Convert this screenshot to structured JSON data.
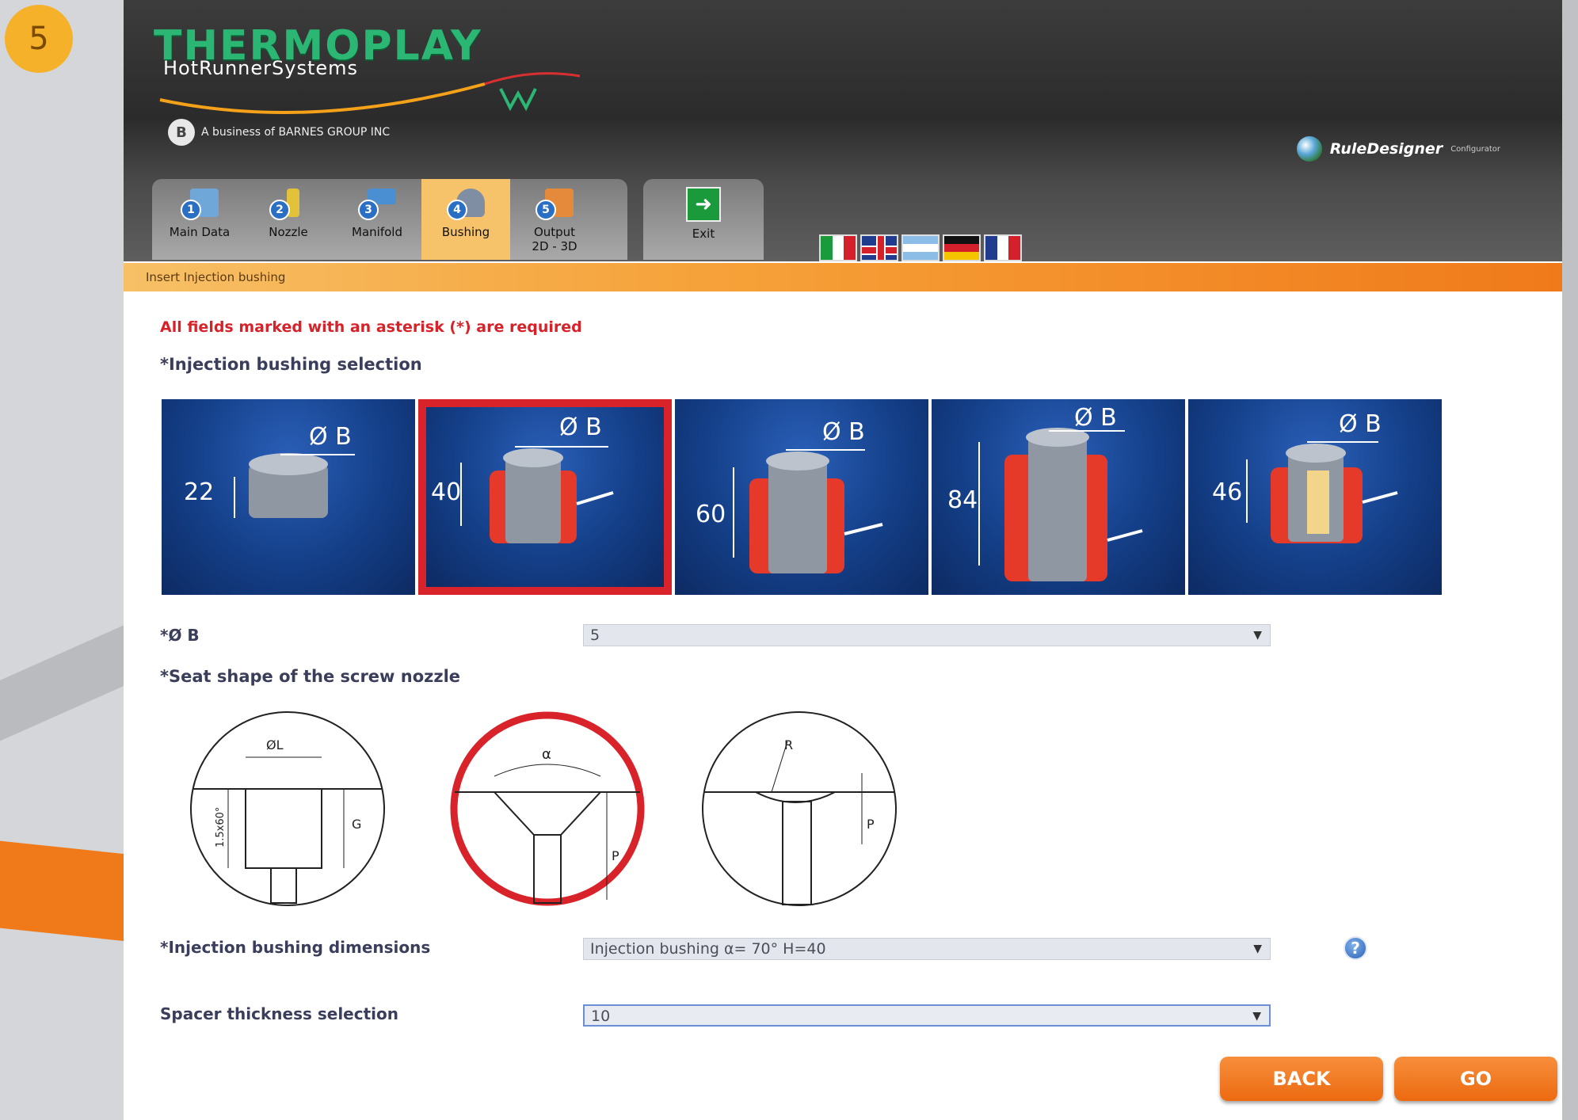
{
  "step_number": "5",
  "header": {
    "logo_title": "THERMOPLAY",
    "logo_subtitle": "HotRunnerSystems",
    "barnes_text": "A business of BARNES GROUP INC",
    "rule_designer": "RuleDesigner",
    "rule_designer_small": "Configurator"
  },
  "tabs": [
    {
      "number": "1",
      "label": "Main Data",
      "color": "#6fa7d8",
      "active": false
    },
    {
      "number": "2",
      "label": "Nozzle",
      "color": "#e2c23a",
      "active": false
    },
    {
      "number": "3",
      "label": "Manifold",
      "color": "#4a8fd1",
      "active": false
    },
    {
      "number": "4",
      "label": "Bushing",
      "color": "#7f8ea3",
      "active": true
    },
    {
      "number": "5",
      "label": "Output\n2D - 3D",
      "color": "#e58a3a",
      "active": false
    }
  ],
  "exit_label": "Exit",
  "flags": [
    "Italian",
    "English",
    "Argentinian",
    "German",
    "French"
  ],
  "status_bar": "Insert Injection bushing",
  "required_note": "All fields marked with an asterisk (*) are required",
  "bushing_section_title": "*Injection bushing selection",
  "bushings": [
    {
      "b_label": "Ø B",
      "height": "22",
      "selected": false
    },
    {
      "b_label": "Ø B",
      "height": "40",
      "selected": true
    },
    {
      "b_label": "Ø B",
      "height": "60",
      "selected": false
    },
    {
      "b_label": "Ø B",
      "height": "84",
      "selected": false
    },
    {
      "b_label": "Ø B",
      "height": "46",
      "selected": false
    }
  ],
  "ob_field": {
    "label": "*Ø B",
    "value": "5"
  },
  "seat_section_title": "*Seat shape of the screw nozzle",
  "seat_shapes": [
    {
      "label_a": "ØL",
      "label_b": "G",
      "label_c": "1.5x60°",
      "selected": false
    },
    {
      "label_a": "α",
      "label_b": "P",
      "selected": true
    },
    {
      "label_a": "R",
      "label_b": "P",
      "selected": false
    }
  ],
  "dimensions_field": {
    "label": "*Injection bushing dimensions",
    "value": "Injection bushing α= 70° H=40"
  },
  "spacer_field": {
    "label": "Spacer thickness selection",
    "value": "10"
  },
  "buttons": {
    "back": "BACK",
    "go": "GO"
  },
  "colors": {
    "accent_orange": "#f07a1a",
    "selected_red": "#d9232b",
    "brand_green": "#2bb673",
    "label_navy": "#3a3e5a"
  }
}
